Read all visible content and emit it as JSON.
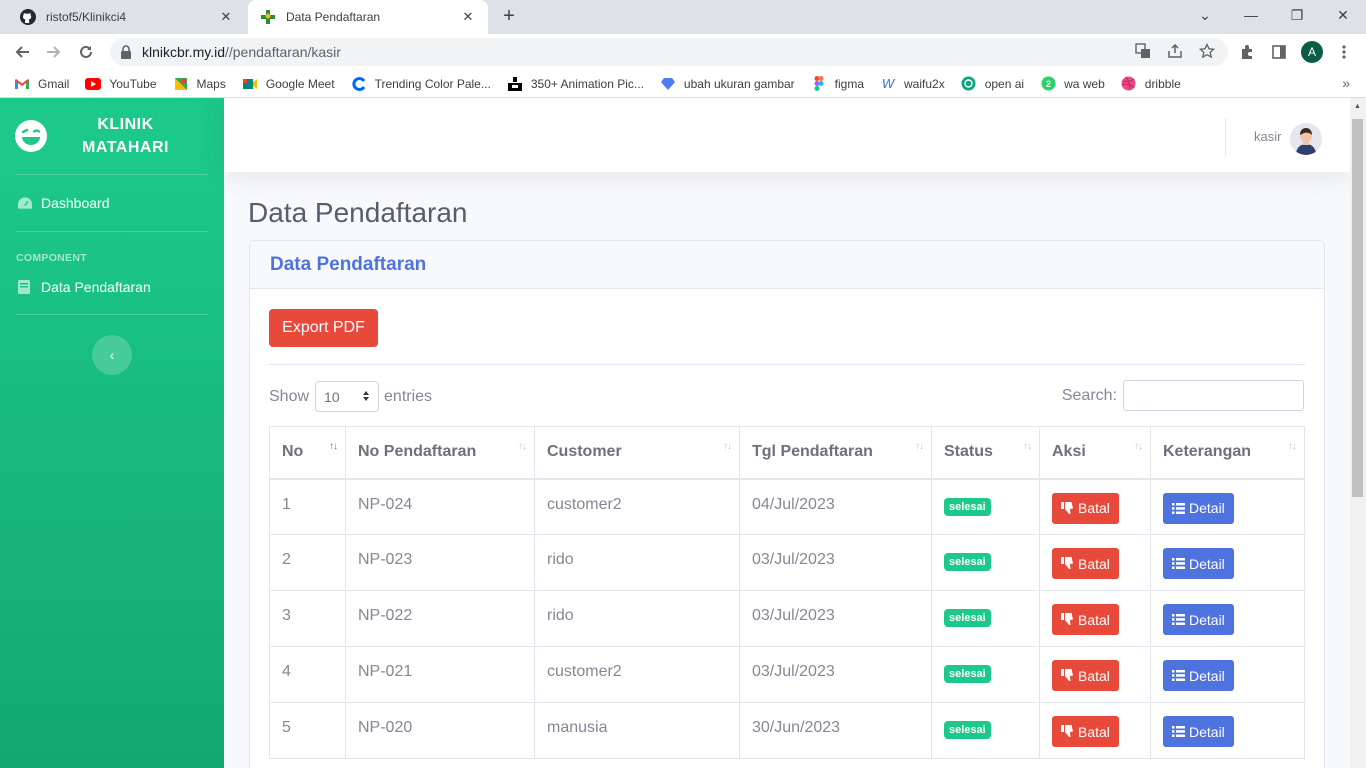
{
  "browser": {
    "tabs": [
      {
        "title": "ristof5/Klinikci4",
        "active": false,
        "icon": "github-icon"
      },
      {
        "title": "Data Pendaftaran",
        "active": true,
        "icon": "clinic-favicon-icon"
      }
    ],
    "new_tab_label": "+",
    "url_host": "klnikcbr.my.id",
    "url_path": "//pendaftaran/kasir",
    "profile_initial": "A",
    "bookmarks": [
      {
        "label": "Gmail",
        "icon": "gmail-icon",
        "color": "#ea4335"
      },
      {
        "label": "YouTube",
        "icon": "youtube-icon",
        "color": "#ff0000"
      },
      {
        "label": "Maps",
        "icon": "maps-icon",
        "color": "#34a853"
      },
      {
        "label": "Google Meet",
        "icon": "meet-icon",
        "color": "#00897b"
      },
      {
        "label": "Trending Color Pale...",
        "icon": "coolors-icon",
        "color": "#0066ff"
      },
      {
        "label": "350+ Animation Pic...",
        "icon": "animation-icon",
        "color": "#000000"
      },
      {
        "label": "ubah ukuran gambar",
        "icon": "resize-icon",
        "color": "#4a7df0"
      },
      {
        "label": "figma",
        "icon": "figma-icon",
        "color": "#f24e1e"
      },
      {
        "label": "waifu2x",
        "icon": "waifu2x-icon",
        "color": "#3b6fd8"
      },
      {
        "label": "open ai",
        "icon": "openai-icon",
        "color": "#10a37f"
      },
      {
        "label": "wa web",
        "icon": "whatsapp-icon",
        "color": "#25d366"
      },
      {
        "label": "dribble",
        "icon": "dribbble-icon",
        "color": "#ea4c89"
      }
    ],
    "bookmarks_more": "»"
  },
  "sidebar": {
    "brand_line1": "KLINIK",
    "brand_line2": "MATAHARI",
    "dashboard_label": "Dashboard",
    "heading": "COMPONENT",
    "pendaftaran_label": "Data Pendaftaran",
    "toggle_symbol": "‹"
  },
  "topbar": {
    "username": "kasir"
  },
  "page": {
    "title": "Data Pendaftaran",
    "card_title": "Data Pendaftaran",
    "export_label": "Export PDF",
    "show_label": "Show",
    "entries_value": "10",
    "entries_label": "entries",
    "search_label": "Search:"
  },
  "table": {
    "columns": [
      "No",
      "No Pendaftaran",
      "Customer",
      "Tgl Pendaftaran",
      "Status",
      "Aksi",
      "Keterangan"
    ],
    "rows": [
      {
        "no": "1",
        "no_pendaftaran": "NP-024",
        "customer": "customer2",
        "tgl": "04/Jul/2023",
        "status": "selesai",
        "aksi": "Batal",
        "keterangan": "Detail"
      },
      {
        "no": "2",
        "no_pendaftaran": "NP-023",
        "customer": "rido",
        "tgl": "03/Jul/2023",
        "status": "selesai",
        "aksi": "Batal",
        "keterangan": "Detail"
      },
      {
        "no": "3",
        "no_pendaftaran": "NP-022",
        "customer": "rido",
        "tgl": "03/Jul/2023",
        "status": "selesai",
        "aksi": "Batal",
        "keterangan": "Detail"
      },
      {
        "no": "4",
        "no_pendaftaran": "NP-021",
        "customer": "customer2",
        "tgl": "03/Jul/2023",
        "status": "selesai",
        "aksi": "Batal",
        "keterangan": "Detail"
      },
      {
        "no": "5",
        "no_pendaftaran": "NP-020",
        "customer": "manusia",
        "tgl": "30/Jun/2023",
        "status": "selesai",
        "aksi": "Batal",
        "keterangan": "Detail"
      }
    ]
  },
  "colors": {
    "primary": "#4e73df",
    "success": "#1cc88a",
    "danger": "#e74a3b"
  }
}
